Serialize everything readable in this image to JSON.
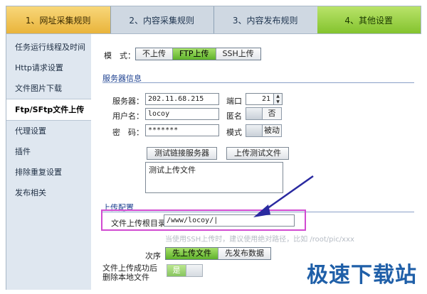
{
  "steps": [
    {
      "label": "1、网址采集规则"
    },
    {
      "label": "2、内容采集规则"
    },
    {
      "label": "3、内容发布规则"
    },
    {
      "label": "4、其他设置"
    }
  ],
  "sidebar": {
    "items": [
      {
        "label": "任务运行线程及时间"
      },
      {
        "label": "Http请求设置"
      },
      {
        "label": "文件图片下载"
      },
      {
        "label": "Ftp/SFtp文件上传"
      },
      {
        "label": "代理设置"
      },
      {
        "label": "插件"
      },
      {
        "label": "排除重复设置"
      },
      {
        "label": "发布相关"
      }
    ]
  },
  "mode": {
    "label": "模　式：",
    "options": [
      "不上传",
      "FTP上传",
      "SSH上传"
    ],
    "selected": "FTP上传"
  },
  "server_section": {
    "title": "服务器信息"
  },
  "server": {
    "host_label": "服务器：",
    "host_value": "202.11.68.215",
    "port_label": "端口",
    "port_value": "21",
    "user_label": "用户名：",
    "user_value": "locoy",
    "anon_label": "匿名",
    "anon_value": "否",
    "pass_label": "密　码：",
    "pass_value": "*******",
    "mode_label": "模式",
    "mode_value": "被动",
    "test_conn_button": "测试链接服务器",
    "test_upload_button": "上传测试文件",
    "log_text": "测试上传文件"
  },
  "upload_section": {
    "title": "上传配置"
  },
  "upload": {
    "root_label": "文件上传根目录",
    "root_value": "/www/locoy/|",
    "hint": "当使用SSH上传时，建议使用绝对路径，比如 /root/pic/xxx",
    "order_label": "次序",
    "order_options": [
      "先上传文件",
      "先发布数据"
    ],
    "order_selected": "先上传文件",
    "delete_label_1": "文件上传成功后",
    "delete_label_2": "删除本地文件",
    "delete_value": "是"
  },
  "watermark": "极速下载站",
  "colors": {
    "accent_green": "#5fb22b",
    "highlight": "#d14bd1",
    "arrow": "#2a2aa0"
  }
}
